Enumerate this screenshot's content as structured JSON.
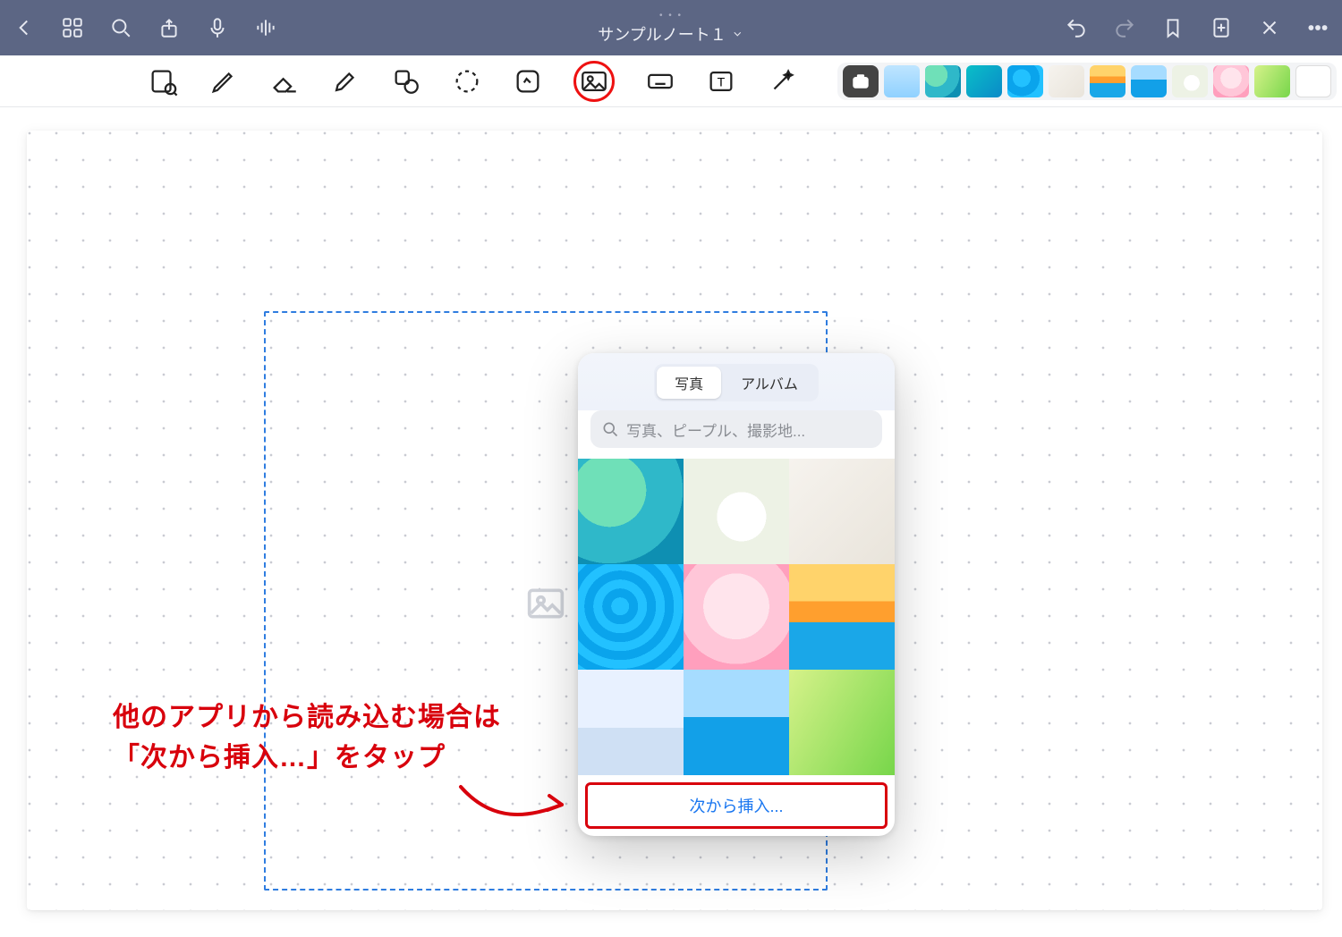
{
  "topbar": {
    "title": "サンプルノート１",
    "grabber": "• • •"
  },
  "annotation": {
    "line1": "他のアプリから読み込む場合は",
    "line2": "「次から挿入…」をタップ"
  },
  "picker": {
    "tabs": {
      "photos": "写真",
      "albums": "アルバム"
    },
    "search_placeholder": "写真、ピープル、撮影地...",
    "insert_label": "次から挿入...",
    "grid_items": [
      "sea-glass",
      "tea-flowers",
      "flatlay-accessories",
      "pool-water",
      "cherry-blossom",
      "sunset-sea",
      "snow-tree",
      "blue-sea",
      "green-leaves"
    ]
  },
  "thumb_strip": [
    "sky-gradient",
    "sea-glass-small",
    "teal",
    "pool",
    "flatlay",
    "sunset",
    "sea",
    "tea",
    "cherry",
    "leaves",
    "last"
  ]
}
